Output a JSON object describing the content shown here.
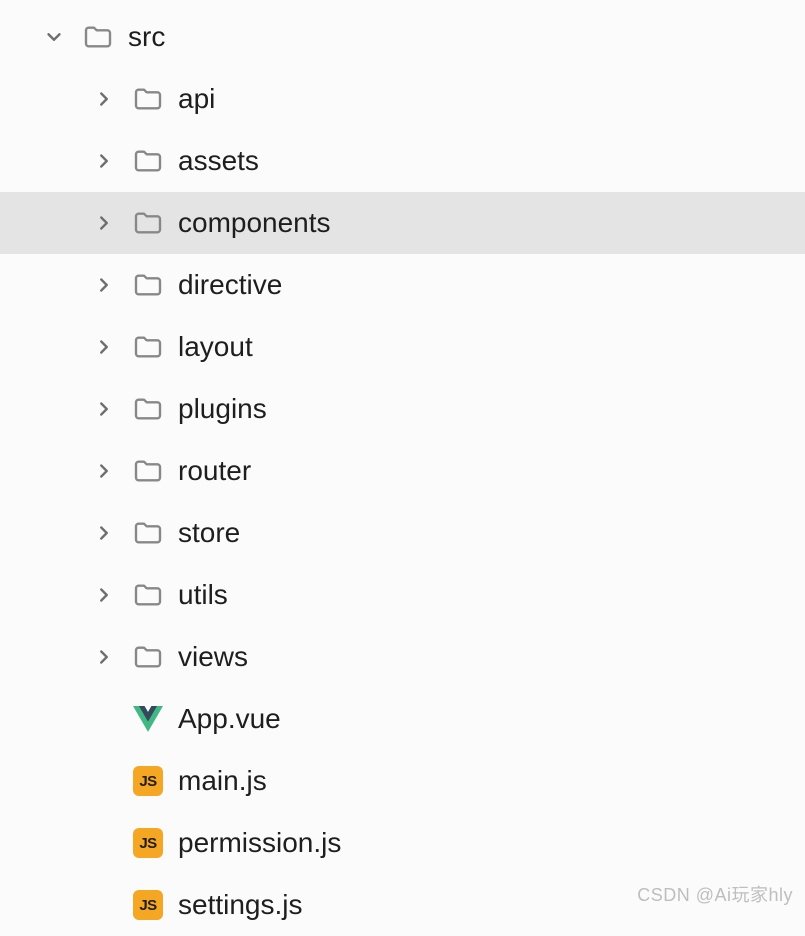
{
  "tree": {
    "root": {
      "label": "src",
      "expanded": true,
      "children": [
        {
          "label": "api",
          "type": "folder",
          "expanded": false
        },
        {
          "label": "assets",
          "type": "folder",
          "expanded": false
        },
        {
          "label": "components",
          "type": "folder",
          "expanded": false,
          "selected": true
        },
        {
          "label": "directive",
          "type": "folder",
          "expanded": false
        },
        {
          "label": "layout",
          "type": "folder",
          "expanded": false
        },
        {
          "label": "plugins",
          "type": "folder",
          "expanded": false
        },
        {
          "label": "router",
          "type": "folder",
          "expanded": false
        },
        {
          "label": "store",
          "type": "folder",
          "expanded": false
        },
        {
          "label": "utils",
          "type": "folder",
          "expanded": false
        },
        {
          "label": "views",
          "type": "folder",
          "expanded": false
        },
        {
          "label": "App.vue",
          "type": "vue"
        },
        {
          "label": "main.js",
          "type": "js"
        },
        {
          "label": "permission.js",
          "type": "js"
        },
        {
          "label": "settings.js",
          "type": "js"
        }
      ]
    }
  },
  "watermark": "CSDN @Ai玩家hly",
  "colors": {
    "selected_bg": "#e4e4e4",
    "folder_stroke": "#707070",
    "js_bg": "#f5a623",
    "vue_green": "#41b883",
    "vue_dark": "#35495e"
  }
}
